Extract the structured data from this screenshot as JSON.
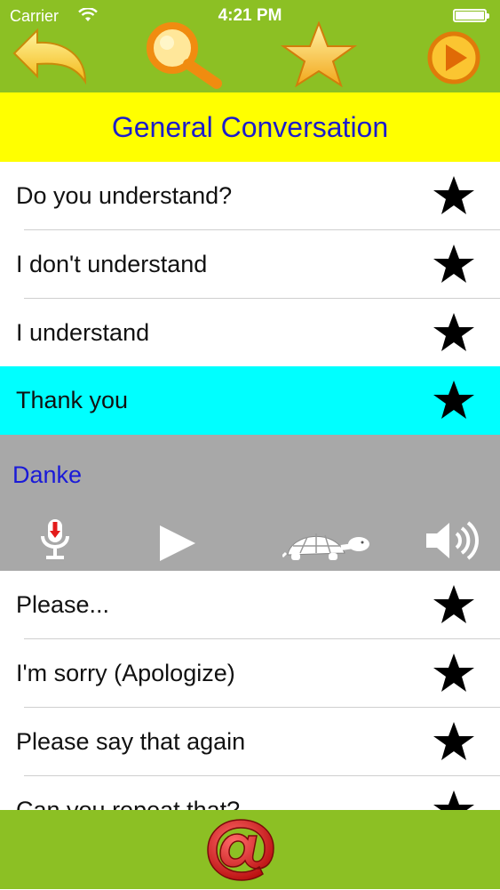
{
  "status_bar": {
    "carrier": "Carrier",
    "time": "4:21 PM"
  },
  "toolbar": {
    "back_icon": "back-arrow-icon",
    "search_icon": "magnifier-icon",
    "favorites_icon": "star-icon",
    "play_icon": "play-circle-icon"
  },
  "header": {
    "title": "General Conversation"
  },
  "phrases": [
    {
      "label": "Do you understand?"
    },
    {
      "label": "I don't understand"
    },
    {
      "label": "I understand"
    },
    {
      "label": "Thank you"
    },
    {
      "label": "Please..."
    },
    {
      "label": "I'm sorry (Apologize)"
    },
    {
      "label": "Please say that again"
    },
    {
      "label": "Can you repeat that?"
    }
  ],
  "selected_phrase": {
    "translation": "Danke",
    "controls": [
      "microphone-icon",
      "play-icon",
      "turtle-slow-icon",
      "speaker-icon"
    ]
  },
  "bottom_bar": {
    "contact_icon": "at-sign-icon"
  },
  "colors": {
    "bar_green": "#8cc024",
    "title_yellow": "#ffff00",
    "title_text": "#1c1ccc",
    "selected_row": "#00ffff",
    "detail_gray": "#a8a8a8",
    "translation_text": "#1a1ad8"
  }
}
